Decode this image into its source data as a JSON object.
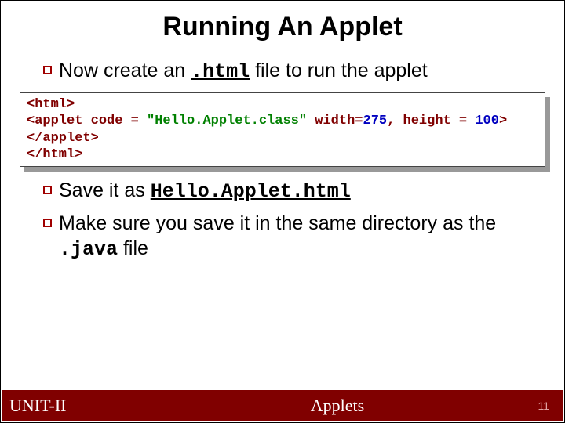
{
  "title": "Running An Applet",
  "bullets": {
    "b1_a": "Now create an ",
    "b1_mono": ".html",
    "b1_b": " file to run the applet",
    "b2_a": "Save it as ",
    "b2_mono": "Hello.Applet.html",
    "b3_a": "Make sure you save it in the same directory as the ",
    "b3_mono": ".java",
    "b3_b": " file"
  },
  "code": {
    "l1": "<html>",
    "l2_a": "<applet code = ",
    "l2_val": "\"Hello.Applet.class\"",
    "l2_b": " width=",
    "l2_w": "275",
    "l2_c": ", height = ",
    "l2_h": "100",
    "l2_d": ">",
    "l3": "</applet>",
    "l4": "</html>"
  },
  "footer": {
    "left": "UNIT-II",
    "center": "Applets",
    "page": "11"
  }
}
